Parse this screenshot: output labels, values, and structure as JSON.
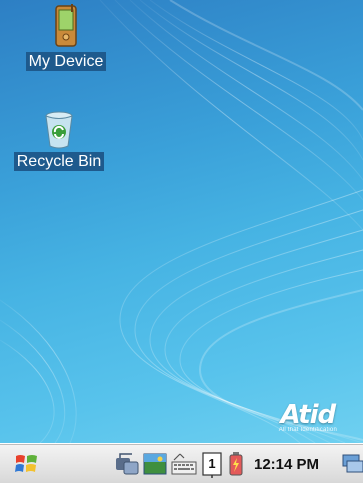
{
  "desktop": {
    "icons": [
      {
        "label": "My Device",
        "icon": "pda-device-icon"
      },
      {
        "label": "Recycle Bin",
        "icon": "recycle-bin-icon"
      }
    ],
    "brand": {
      "logo": "Atid",
      "tagline": "All that Identification"
    }
  },
  "taskbar": {
    "start_icon": "windows-flag-icon",
    "tray_icons": [
      "connectivity-icon",
      "wallpaper-app-icon",
      "keyboard-icon",
      "input-panel-icon",
      "battery-icon"
    ],
    "input_panel_value": "1",
    "clock": "12:14 PM",
    "desktop_icon": "show-desktop-icon"
  },
  "colors": {
    "desktop_top": "#2d7fc4",
    "desktop_bottom": "#6fd0f0",
    "label_bg": "#1e5a8d",
    "taskbar": "#e6e6e6"
  }
}
